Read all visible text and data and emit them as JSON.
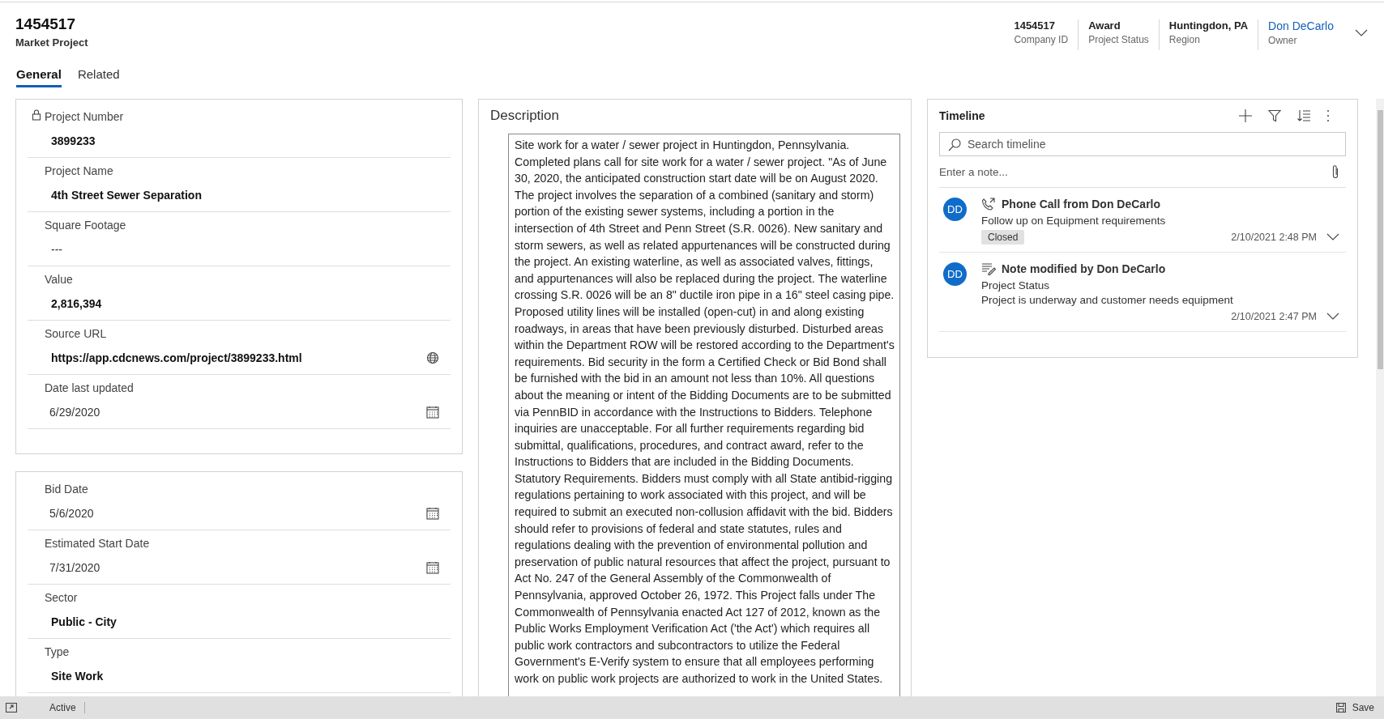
{
  "header": {
    "title": "1454517",
    "subtitle": "Market Project",
    "fields": [
      {
        "value": "1454517",
        "label": "Company ID",
        "kind": "text"
      },
      {
        "value": "Award",
        "label": "Project Status",
        "kind": "text"
      },
      {
        "value": "Huntingdon, PA",
        "label": "Region",
        "kind": "text"
      },
      {
        "value": "Don DeCarlo",
        "label": "Owner",
        "kind": "link"
      }
    ]
  },
  "tabs": [
    {
      "label": "General",
      "selected": true
    },
    {
      "label": "Related",
      "selected": false
    }
  ],
  "sections": [
    {
      "fields": [
        {
          "label": "Project Number",
          "value": "3899233",
          "kind": "text",
          "locked": true
        },
        {
          "label": "Project Name",
          "value": "4th Street Sewer Separation",
          "kind": "text",
          "locked": false
        },
        {
          "label": "Square Footage",
          "value": "---",
          "kind": "empty",
          "locked": false
        },
        {
          "label": "Value",
          "value": "2,816,394",
          "kind": "text",
          "locked": false
        },
        {
          "label": "Source URL",
          "value": "https://app.cdcnews.com/project/3899233.html",
          "kind": "url",
          "locked": false
        },
        {
          "label": "Date last updated",
          "value": "6/29/2020",
          "kind": "date",
          "locked": false
        }
      ]
    },
    {
      "fields": [
        {
          "label": "Bid Date",
          "value": "5/6/2020",
          "kind": "date",
          "locked": false
        },
        {
          "label": "Estimated Start Date",
          "value": "7/31/2020",
          "kind": "date",
          "locked": false
        },
        {
          "label": "Sector",
          "value": "Public - City",
          "kind": "text",
          "locked": false
        },
        {
          "label": "Type",
          "value": "Site Work",
          "kind": "text",
          "locked": false
        }
      ]
    }
  ],
  "description": {
    "title": "Description",
    "value": "Site work for a water / sewer project in Huntingdon, Pennsylvania. Completed plans call for site work for a water / sewer project. \"As of June 30, 2020, the anticipated construction start date will be on August 2020. The project involves the separation of a combined (sanitary and storm) portion of the existing sewer systems, including a portion in the intersection of 4th Street and Penn Street (S.R. 0026). New sanitary and storm sewers, as well as related appurtenances will be constructed during the project. An existing waterline, as well as associated valves, fittings, and appurtenances will also be replaced during the project. The waterline crossing S.R. 0026 will be an 8\" ductile iron pipe in a 16\" steel casing pipe. Proposed utility lines will be installed (open-cut) in and along existing roadways, in areas that have been previously disturbed. Disturbed areas within the Department ROW will be restored according to the Department's requirements. Bid security in the form a Certified Check or Bid Bond shall be furnished with the bid in an amount not less than 10%. All questions about the meaning or intent of the Bidding Documents are to be submitted via PennBID in accordance with the Instructions to Bidders. Telephone inquiries are unacceptable. For all further requirements regarding bid submittal, qualifications, procedures, and contract award, refer to the Instructions to Bidders that are included in the Bidding Documents. Statutory Requirements. Bidders must comply with all State antibid-rigging regulations pertaining to work associated with this project, and will be required to submit an executed non-collusion affidavit with the bid. Bidders should refer to provisions of federal and state statutes, rules and regulations dealing with the prevention of environmental pollution and preservation of public natural resources that affect the project, pursuant to Act No. 247 of the General Assembly of the Commonwealth of Pennsylvania, approved October 26, 1972. This Project falls under The Commonwealth of Pennsylvania enacted Act 127 of 2012, known as the Public Works Employment Verification Act ('the Act') which requires all public work contractors and subcontractors to utilize the Federal Government's E-Verify system to ensure that all employees performing work on public work projects are authorized to work in the United States."
  },
  "timeline": {
    "title": "Timeline",
    "search": {
      "placeholder": "Search timeline"
    },
    "note": {
      "placeholder": "Enter a note..."
    },
    "entries": [
      {
        "initials": "DD",
        "kind": "phone",
        "title": "Phone Call from Don DeCarlo",
        "lines": [
          "Follow up on Equipment requirements"
        ],
        "badge": "Closed",
        "time": "2/10/2021 2:48 PM"
      },
      {
        "initials": "DD",
        "kind": "note",
        "title": "Note modified by Don DeCarlo",
        "lines": [
          "Project Status",
          "Project is underway and customer needs equipment"
        ],
        "time": "2/10/2021 2:47 PM"
      }
    ]
  },
  "status_bar": {
    "status": "Active",
    "save": "Save"
  }
}
